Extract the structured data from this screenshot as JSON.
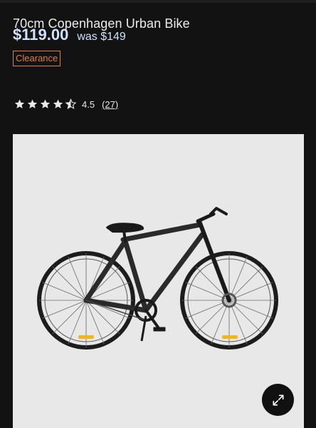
{
  "product": {
    "title": "70cm Copenhagen Urban Bike",
    "price": "$119.00",
    "was_price": "was $149",
    "badge": "Clearance",
    "rating": {
      "stars": 4.5,
      "value_text": "4.5",
      "review_count_text": "(27)"
    }
  },
  "image": {
    "alt": "70cm Copenhagen Urban Bike",
    "zoom_icon": "expand-arrows-icon"
  },
  "colors": {
    "background": "#121212",
    "price": "#d0e2ff",
    "badge": "#e07b4a"
  }
}
